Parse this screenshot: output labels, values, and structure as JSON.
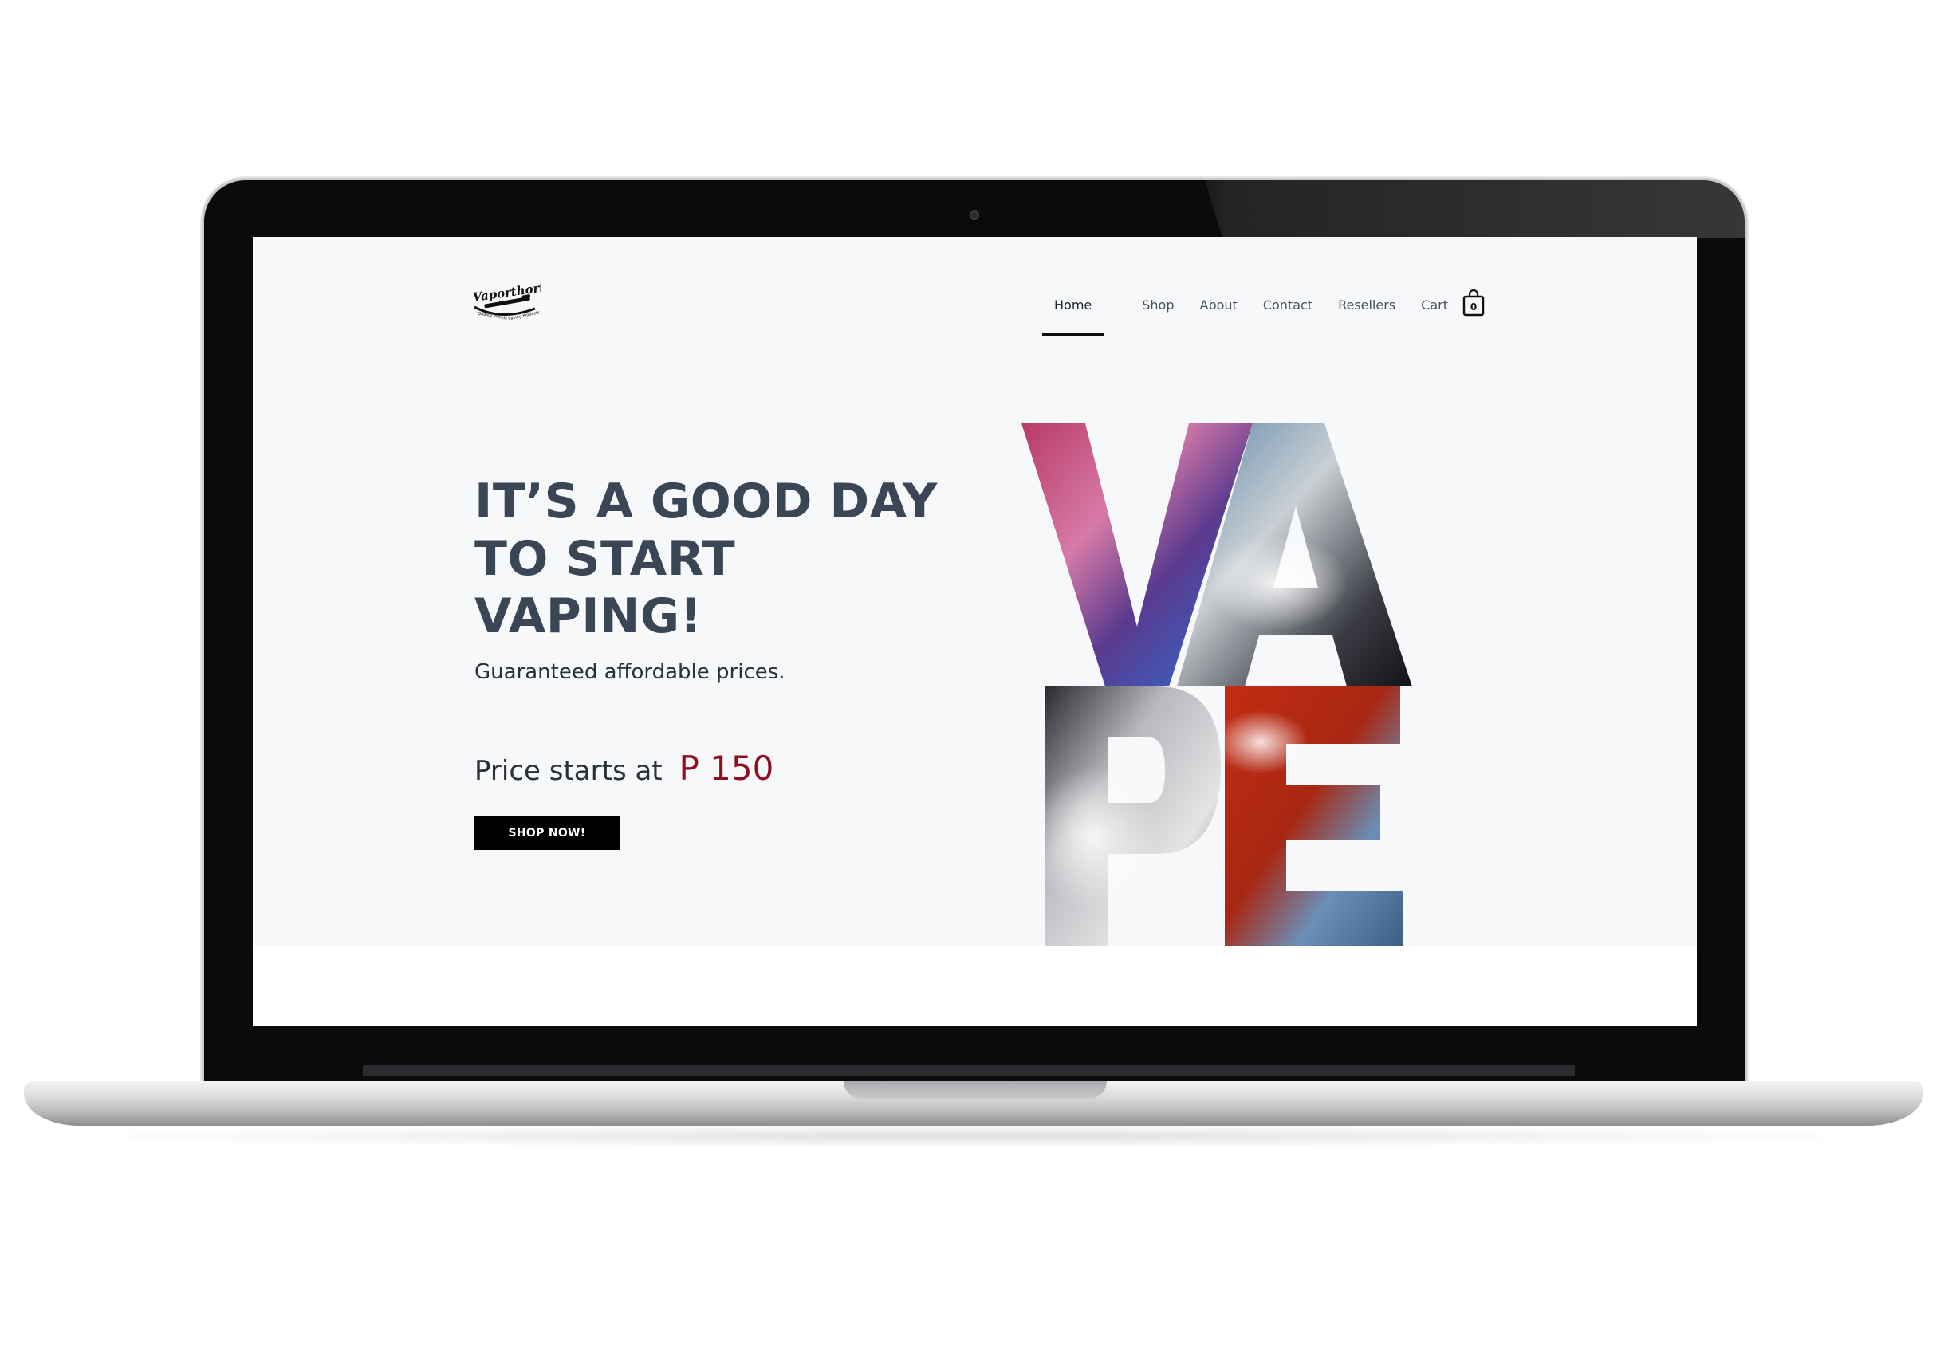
{
  "brand": {
    "logo_text": "Vaporthority",
    "logo_tagline": "Quality Brands · Vaping Products"
  },
  "nav": {
    "items": [
      {
        "label": "Home",
        "active": true
      },
      {
        "label": "Shop"
      },
      {
        "label": "About"
      },
      {
        "label": "Contact"
      },
      {
        "label": "Resellers"
      },
      {
        "label": "Cart"
      }
    ],
    "cart_count": "0",
    "cart_icon": "shopping-bag-icon"
  },
  "hero": {
    "headline_lines": [
      "IT’S A GOOD DAY",
      "TO START",
      "VAPING!"
    ],
    "subheadline": "Guaranteed affordable prices.",
    "price_prefix": "Price starts at",
    "price_value": "P 150",
    "cta_label": "SHOP NOW!",
    "art_letters": [
      "V",
      "A",
      "P",
      "E"
    ]
  },
  "colors": {
    "headline": "#3a4656",
    "price_accent": "#8e1020",
    "button_bg": "#000000",
    "hero_bg": "#f7f8f9"
  }
}
